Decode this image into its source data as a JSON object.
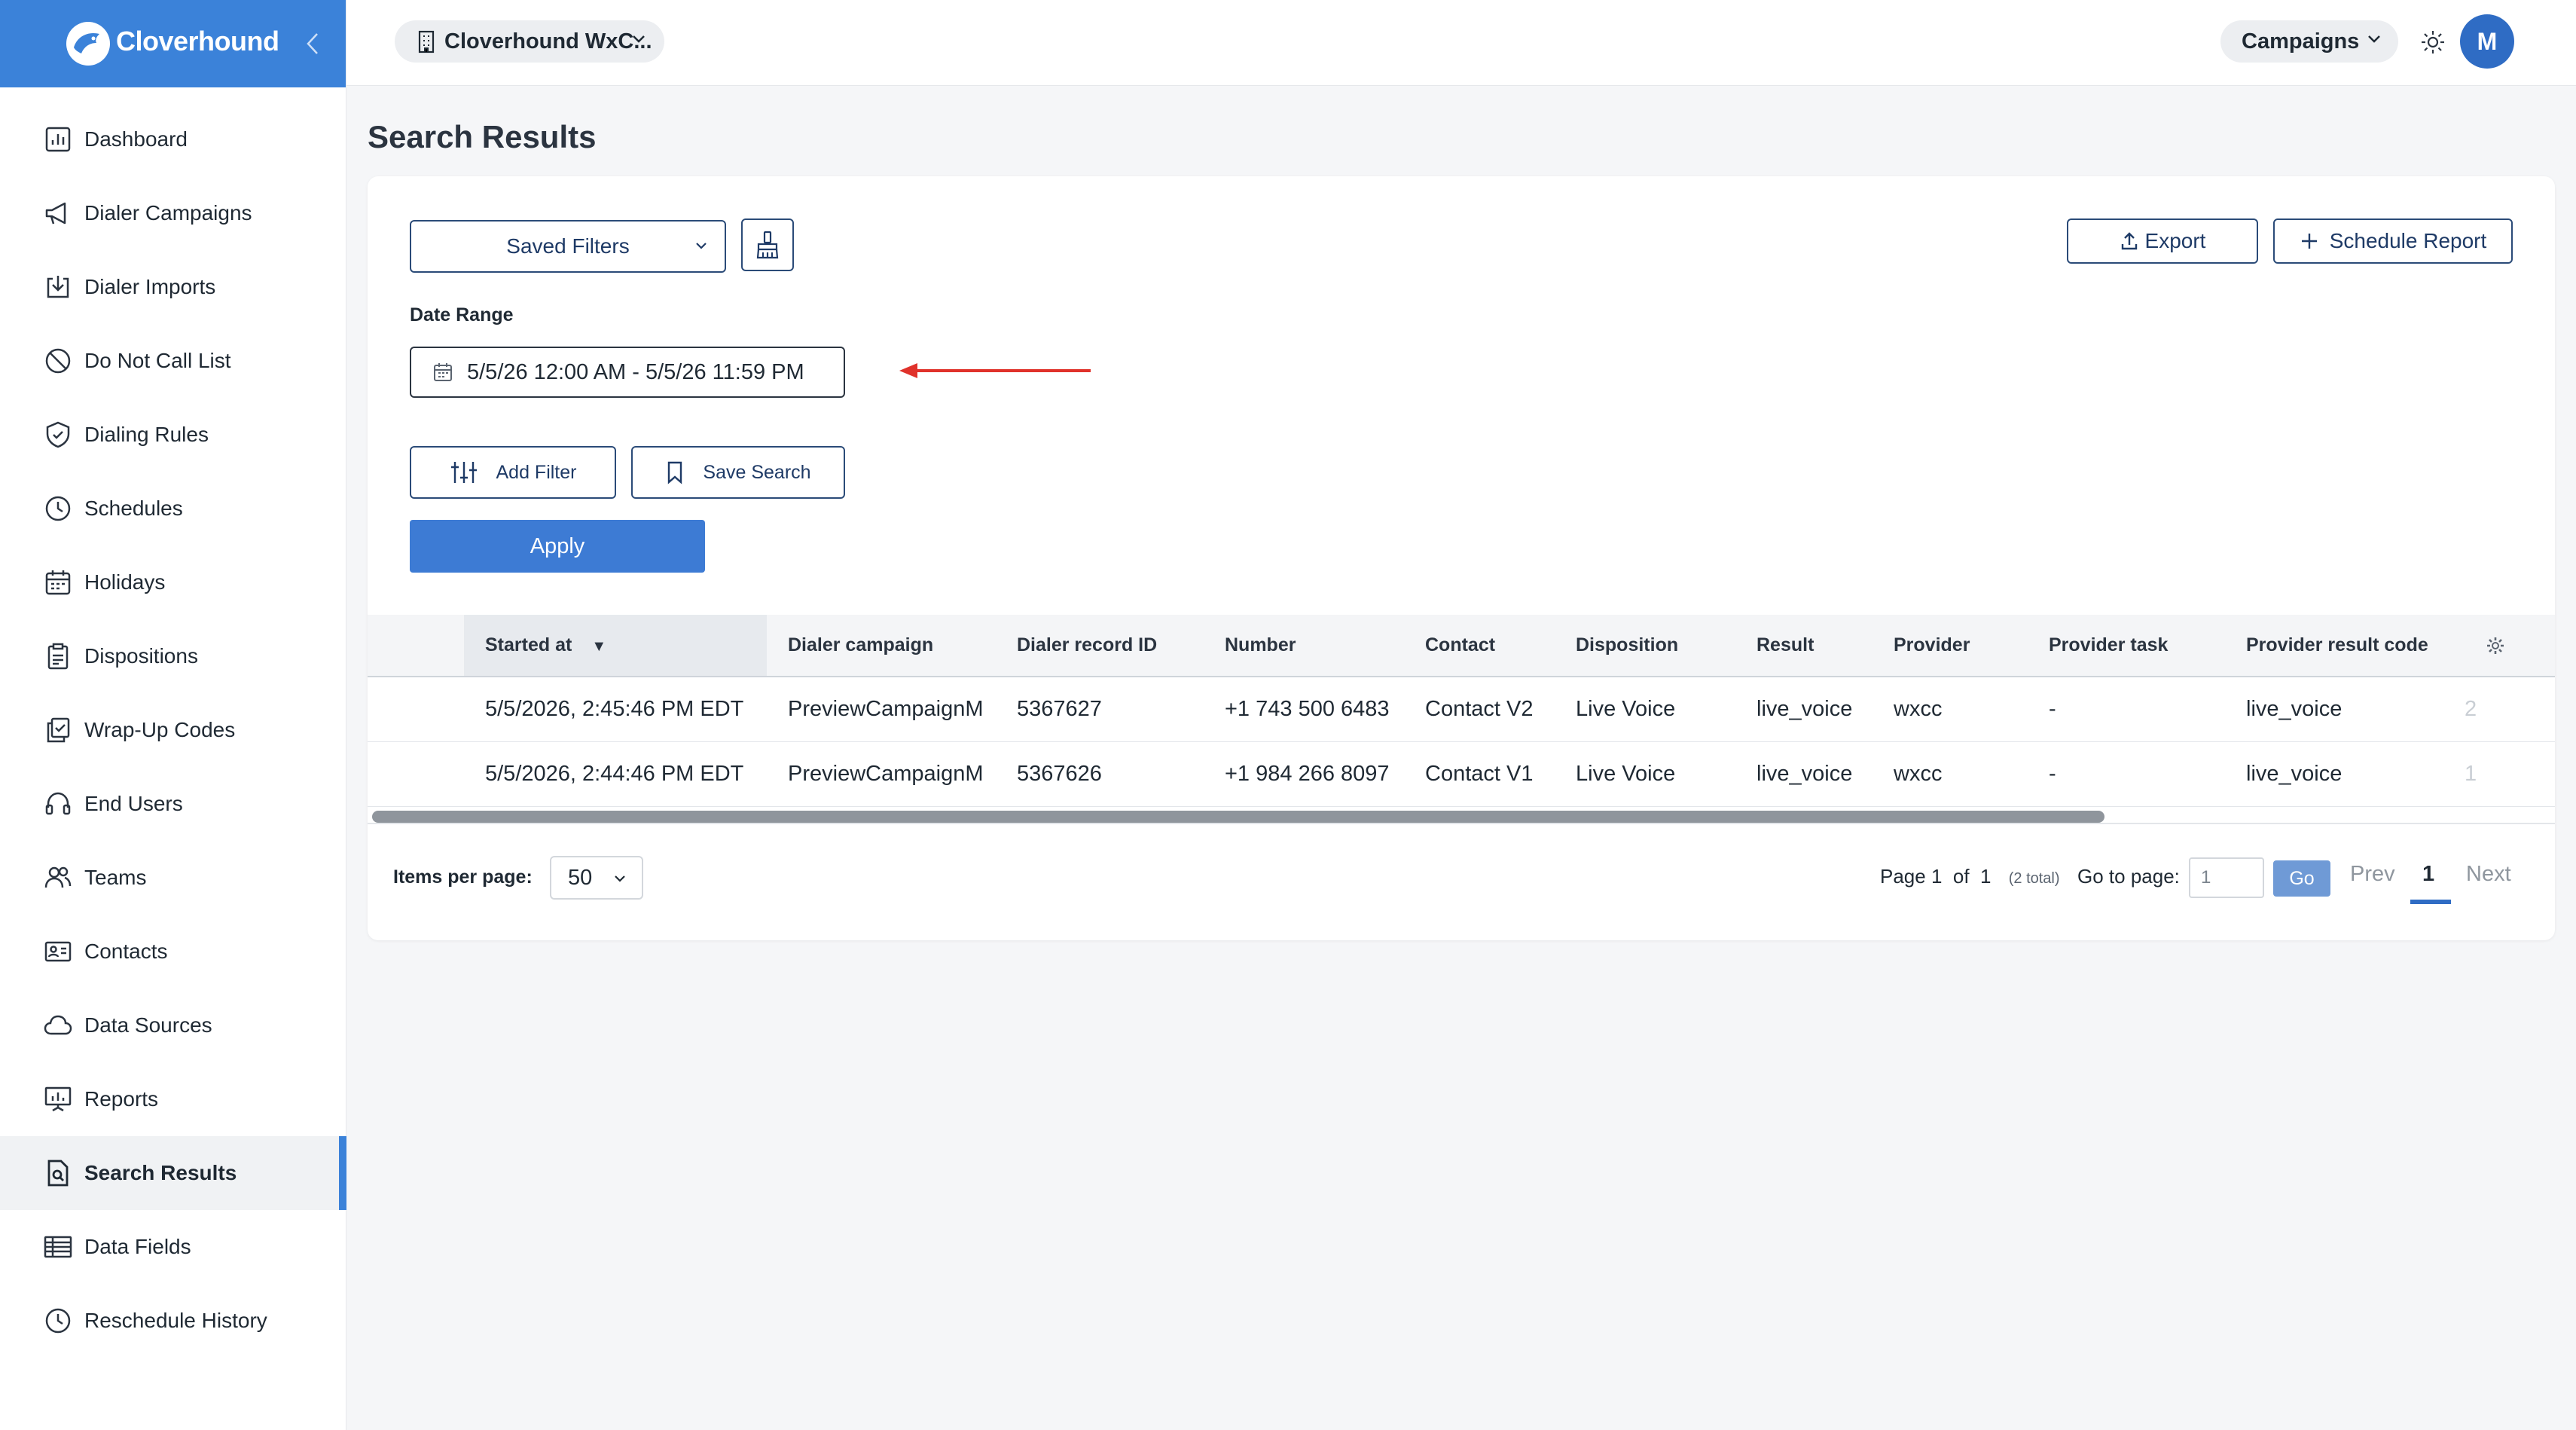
{
  "brand": {
    "name": "Cloverhound"
  },
  "sidebar": {
    "items": [
      {
        "label": "Dashboard",
        "icon": "bar-chart-icon"
      },
      {
        "label": "Dialer Campaigns",
        "icon": "megaphone-icon"
      },
      {
        "label": "Dialer Imports",
        "icon": "import-icon"
      },
      {
        "label": "Do Not Call List",
        "icon": "ban-icon"
      },
      {
        "label": "Dialing Rules",
        "icon": "shield-check-icon"
      },
      {
        "label": "Schedules",
        "icon": "clock-icon"
      },
      {
        "label": "Holidays",
        "icon": "calendar-icon"
      },
      {
        "label": "Dispositions",
        "icon": "clipboard-icon"
      },
      {
        "label": "Wrap-Up Codes",
        "icon": "copy-check-icon"
      },
      {
        "label": "End Users",
        "icon": "headset-icon"
      },
      {
        "label": "Teams",
        "icon": "users-icon"
      },
      {
        "label": "Contacts",
        "icon": "contact-card-icon"
      },
      {
        "label": "Data Sources",
        "icon": "cloud-icon"
      },
      {
        "label": "Reports",
        "icon": "presentation-chart-icon"
      },
      {
        "label": "Search Results",
        "icon": "file-search-icon",
        "active": true
      },
      {
        "label": "Data Fields",
        "icon": "table-icon"
      },
      {
        "label": "Reschedule History",
        "icon": "history-clock-icon"
      }
    ]
  },
  "topbar": {
    "org": "Cloverhound WxC...",
    "campaigns": "Campaigns",
    "avatar_initial": "M"
  },
  "page": {
    "title": "Search Results"
  },
  "filters": {
    "saved_filters": "Saved Filters",
    "date_range_label": "Date Range",
    "date_range_value": "5/5/26 12:00 AM - 5/5/26 11:59 PM",
    "add_filter": "Add Filter",
    "save_search": "Save Search",
    "apply": "Apply",
    "export": "Export",
    "schedule_report": "Schedule Report"
  },
  "table": {
    "columns": [
      "Started at",
      "Dialer campaign",
      "Dialer record ID",
      "Number",
      "Contact",
      "Disposition",
      "Result",
      "Provider",
      "Provider task",
      "Provider result code"
    ],
    "rows": [
      [
        "5/5/2026, 2:45:46 PM EDT",
        "PreviewCampaignM",
        "5367627",
        "+1 743 500 6483",
        "Contact V2",
        "Live Voice",
        "live_voice",
        "wxcc",
        "-",
        "live_voice",
        "2"
      ],
      [
        "5/5/2026, 2:44:46 PM EDT",
        "PreviewCampaignM",
        "5367626",
        "+1 984 266 8097",
        "Contact V1",
        "Live Voice",
        "live_voice",
        "wxcc",
        "-",
        "live_voice",
        "1"
      ]
    ]
  },
  "pagination": {
    "items_per_page_label": "Items per page:",
    "items_per_page": "50",
    "page_word": "Page",
    "current": "1",
    "of_word": "of",
    "total_pages": "1",
    "total_note": "(2 total)",
    "goto_label": "Go to page:",
    "goto_value": "1",
    "go": "Go",
    "prev": "Prev",
    "next": "Next"
  },
  "colors": {
    "accent": "#3b82d9",
    "button_primary": "#3d7bd4",
    "arrow": "#e0322b"
  }
}
